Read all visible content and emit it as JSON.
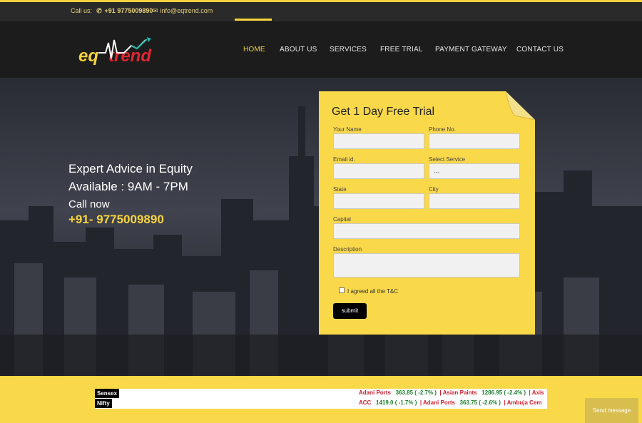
{
  "topbar": {
    "call_label": "Call us:",
    "phone": "+91 9775009890",
    "email": "info@eqtrend.com"
  },
  "brand": {
    "logo_text_a": "eq",
    "logo_text_b": "trend"
  },
  "nav": {
    "items": [
      "HOME",
      "ABOUT US",
      "SERVICES",
      "FREE TRIAL",
      "PAYMENT GATEWAY",
      "CONTACT US"
    ],
    "active": "HOME"
  },
  "hero": {
    "line1": "Expert Advice in Equity",
    "line2": "Available : 9AM - 7PM",
    "line3": "Call now",
    "line4": "+91- 9775009890"
  },
  "form": {
    "title": "Get 1 Day Free Trial",
    "name_label": "Your Name",
    "phone_label": "Phone No.",
    "email_label": "Email id.",
    "service_label": "Select Service",
    "service_value": "---",
    "state_label": "State",
    "city_label": "City",
    "capital_label": "Capital",
    "description_label": "Description",
    "agree_label": "I agreed all the T&C",
    "submit_label": "submit"
  },
  "ticker": {
    "sensex_label": "Sensex",
    "nifty_label": "Nifty",
    "sensex_row": [
      {
        "name": "Adani Ports",
        "value": "363.85 ( -2.7% )"
      },
      {
        "name": "Asian Paints",
        "value": "1286.95 ( -2.4% )"
      },
      {
        "name": "Axis",
        "value": ""
      }
    ],
    "nifty_row": [
      {
        "name": "ACC",
        "value": "1419.0 ( -1.7% )"
      },
      {
        "name": "Adani Ports",
        "value": "363.75 ( -2.6% )"
      },
      {
        "name": "Ambuja Cem",
        "value": ""
      }
    ]
  },
  "chat": {
    "send_message": "Send message"
  },
  "colors": {
    "accent": "#f7d23e",
    "down_name": "#cc1f2b",
    "down_value": "#1c7c2b"
  }
}
